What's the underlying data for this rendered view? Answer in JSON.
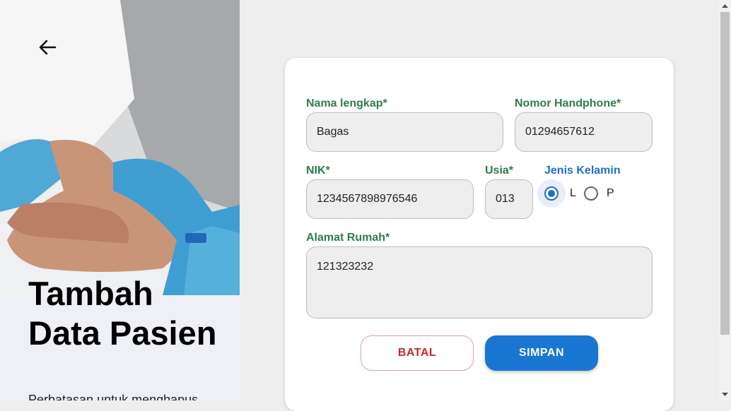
{
  "left_panel": {
    "title": "Tambah Data Pasien",
    "subtitle": "Perbatasan untuk menghapus"
  },
  "form": {
    "name": {
      "label": "Nama lengkap*",
      "value": "Bagas"
    },
    "phone": {
      "label": "Nomor Handphone*",
      "value": "01294657612"
    },
    "nik": {
      "label": "NIK*",
      "value": "1234567898976546"
    },
    "age": {
      "label": "Usia*",
      "value": "013"
    },
    "gender": {
      "label": "Jenis Kelamin",
      "options": [
        "L",
        "P"
      ],
      "selected": "L"
    },
    "address": {
      "label": "Alamat Rumah*",
      "value": "121323232"
    }
  },
  "actions": {
    "cancel_label": "BATAL",
    "save_label": "SIMPAN"
  },
  "colors": {
    "label_green": "#2e7d4f",
    "label_blue": "#1e6fc8",
    "primary": "#1976d2",
    "cancel": "#c62828"
  },
  "icons": {
    "back": "arrow-left-icon"
  }
}
